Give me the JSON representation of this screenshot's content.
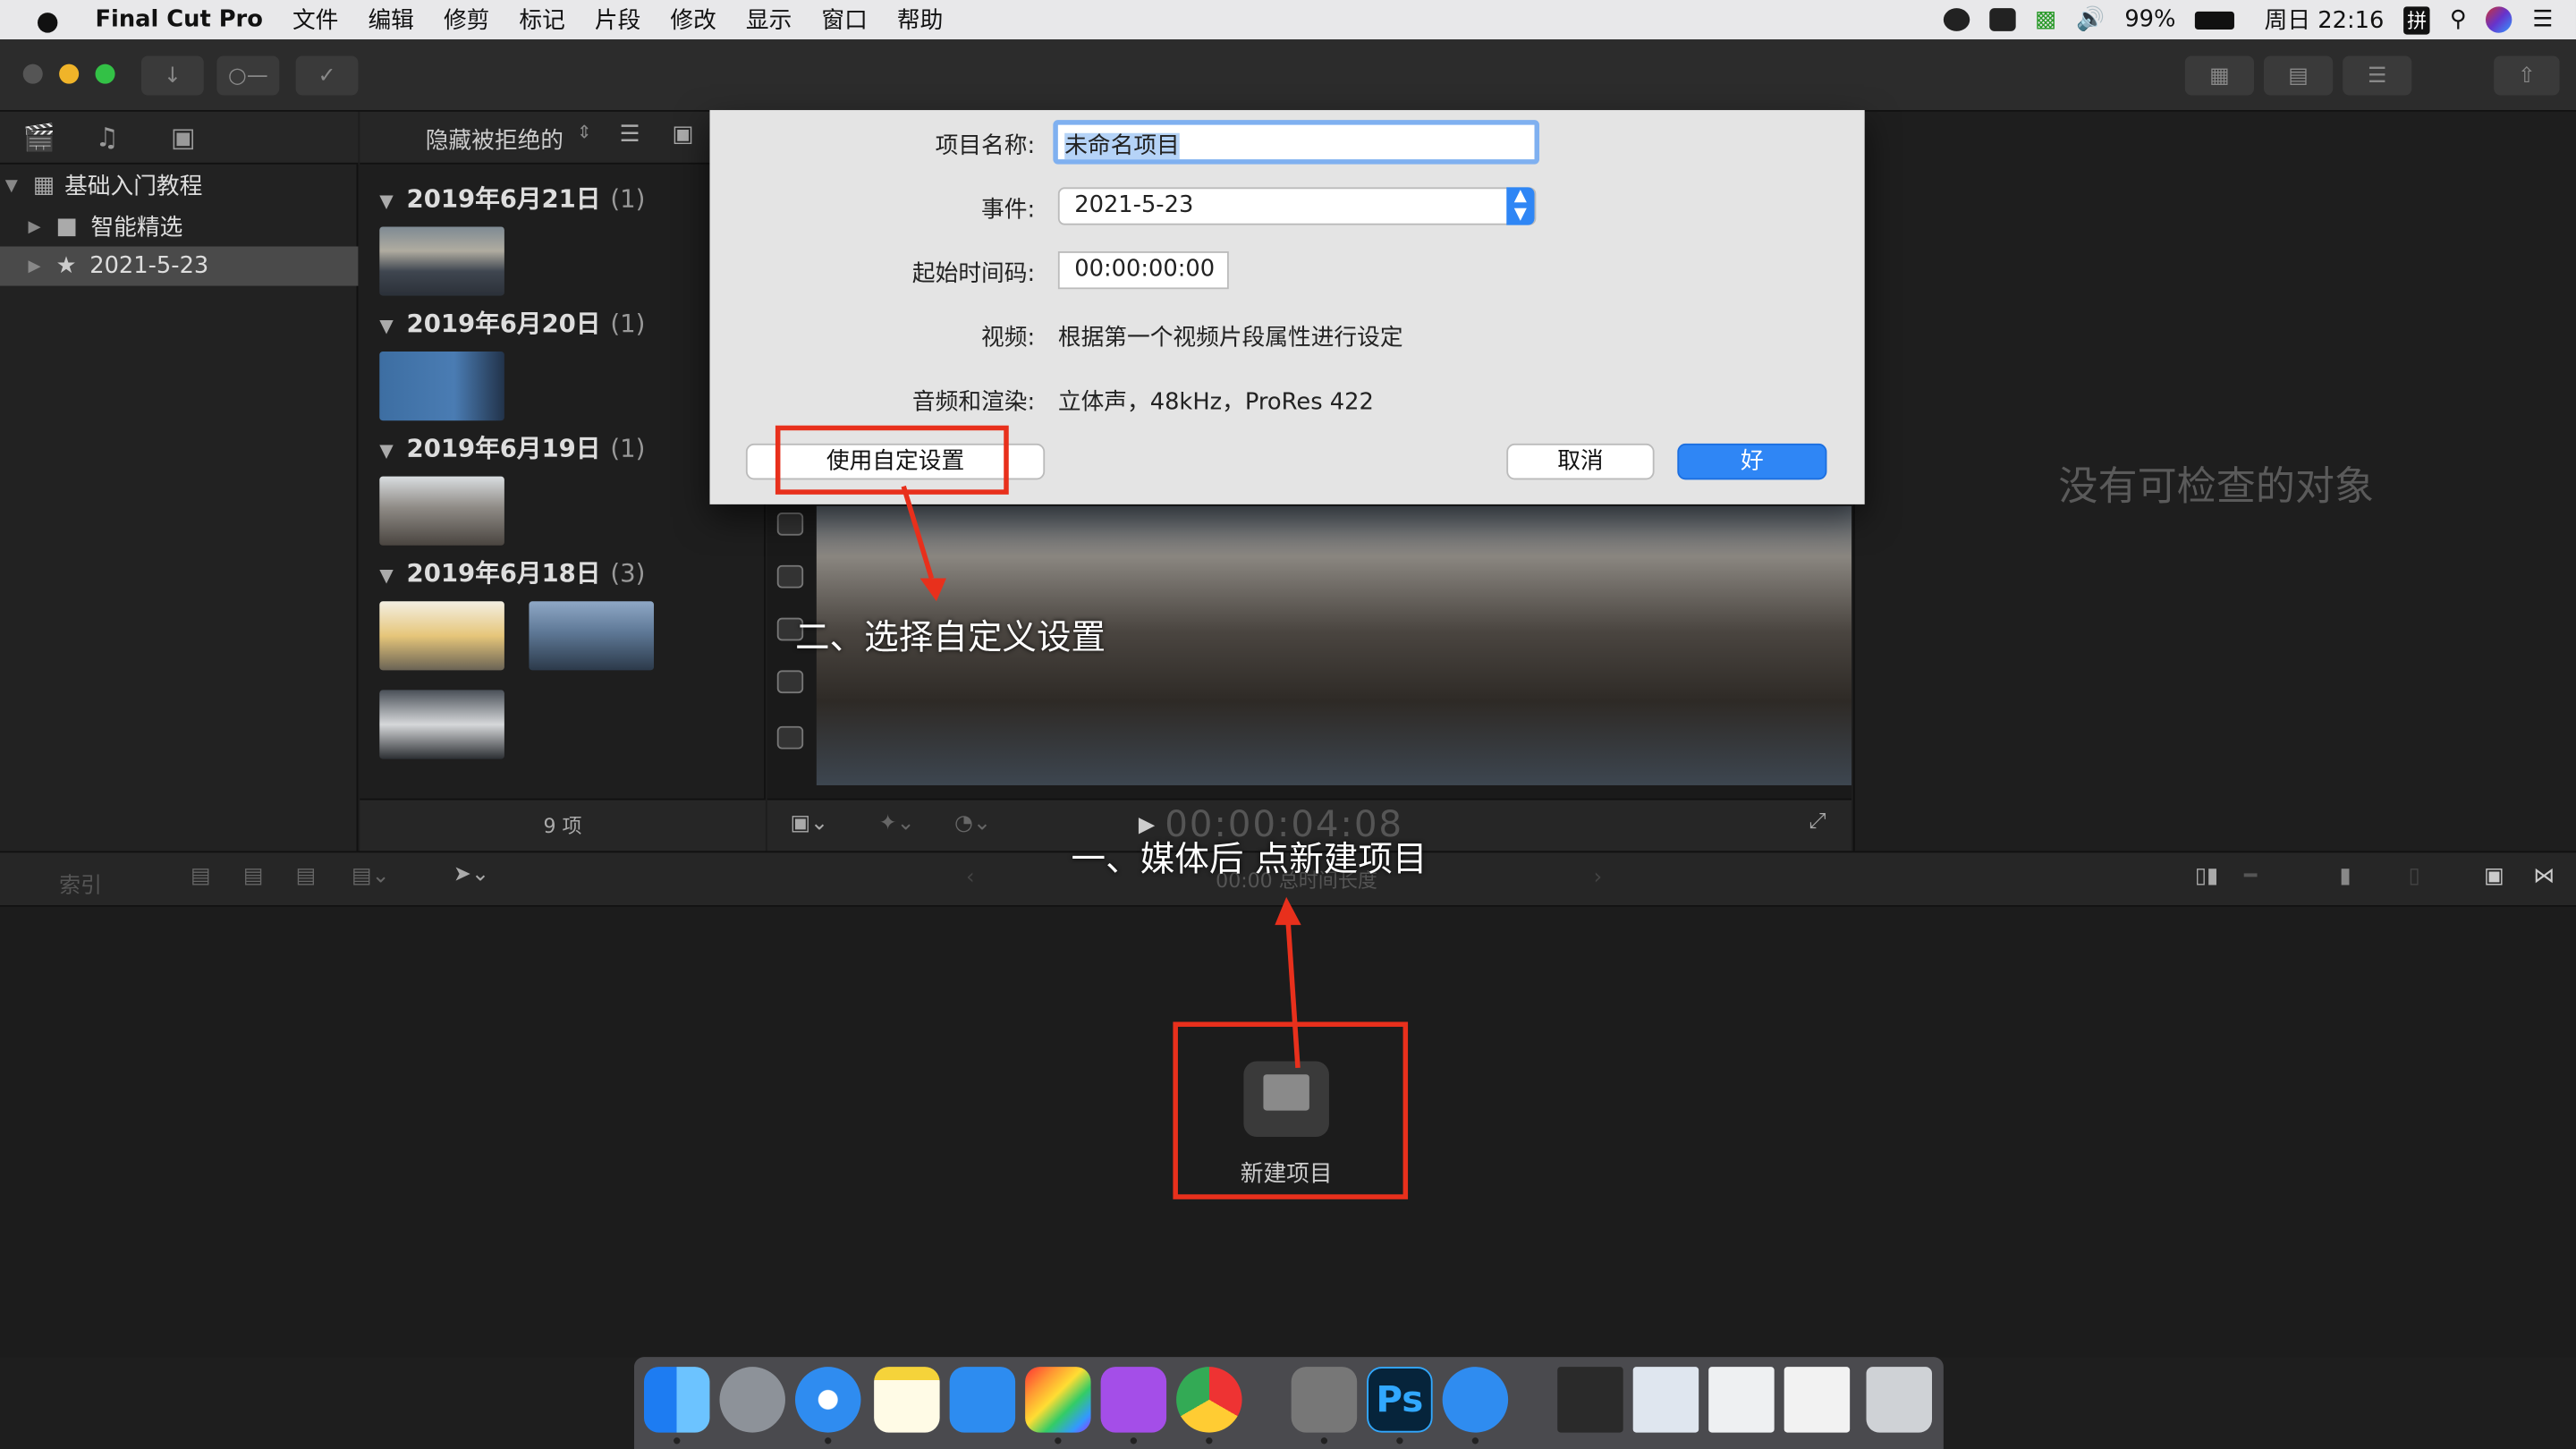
{
  "menubar": {
    "apple": "",
    "app_name": "Final Cut Pro",
    "items": [
      "文件",
      "编辑",
      "修剪",
      "标记",
      "片段",
      "修改",
      "显示",
      "窗口",
      "帮助"
    ],
    "battery": "99%",
    "clock": "周日 22:16",
    "input_method": "拼"
  },
  "library": {
    "items": [
      {
        "label": "基础入门教程"
      },
      {
        "label": "智能精选"
      },
      {
        "label": "2021-5-23"
      }
    ]
  },
  "browser": {
    "filter": "隐藏被拒绝的",
    "groups": [
      {
        "date": "2019年6月21日",
        "count": "(1)"
      },
      {
        "date": "2019年6月20日",
        "count": "(1)"
      },
      {
        "date": "2019年6月19日",
        "count": "(1)"
      },
      {
        "date": "2019年6月18日",
        "count": "(3)"
      }
    ],
    "footer": "9 项"
  },
  "viewer": {
    "timecode": "00:00:04:08",
    "duration": "00:00 总时间长度"
  },
  "inspector": {
    "empty_text": "没有可检查的对象"
  },
  "timeline": {
    "index_label": "索引",
    "new_project": "新建项目"
  },
  "dialog": {
    "name_label": "项目名称:",
    "name_value": "未命名项目",
    "event_label": "事件:",
    "event_value": "2021-5-23",
    "tc_label": "起始时间码:",
    "tc_value": "00:00:00:00",
    "video_label": "视频:",
    "video_value": "根据第一个视频片段属性进行设定",
    "audio_label": "音频和渲染:",
    "audio_value": "立体声，48kHz，ProRes 422",
    "custom_button": "使用自定设置",
    "cancel_button": "取消",
    "ok_button": "好"
  },
  "annotations": {
    "step2": "二、选择自定义设置",
    "step1": "一、媒体后 点新建项目"
  },
  "colors": {
    "accent": "#2f86f5",
    "annotation_red": "#e8301c"
  }
}
